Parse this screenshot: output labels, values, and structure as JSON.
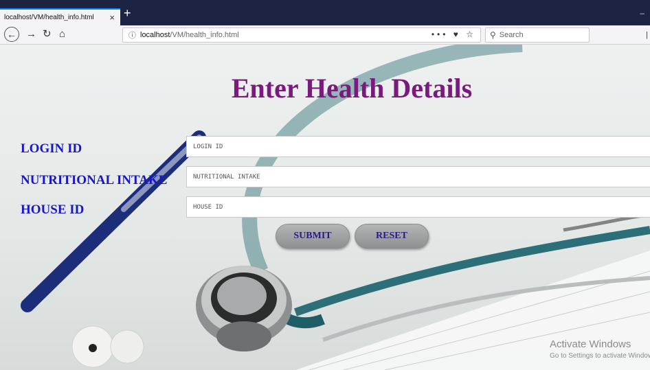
{
  "browser": {
    "tab_title": "localhost/VM/health_info.html",
    "close_glyph": "×",
    "new_tab_glyph": "+",
    "minimize_glyph": "–",
    "url_host": "localhost",
    "url_path": "/VM/health_info.html",
    "page_actions": "•••  ♥  ☆",
    "search_placeholder": "Search",
    "icons": [
      "back-arrow-icon",
      "forward-arrow-icon",
      "reload-icon",
      "home-icon",
      "info-icon",
      "pocket-icon",
      "bookmark-star-icon",
      "search-icon",
      "library-icon"
    ]
  },
  "page": {
    "heading": "Enter Health Details",
    "fields": [
      {
        "label": "LOGIN ID",
        "placeholder": "LOGIN ID"
      },
      {
        "label": "NUTRITIONAL INTAKE",
        "placeholder": "NUTRITIONAL INTAKE"
      },
      {
        "label": "HOUSE ID",
        "placeholder": "HOUSE ID"
      }
    ],
    "buttons": {
      "submit": "SUBMIT",
      "reset": "RESET"
    }
  },
  "watermark": {
    "line1": "Activate Windows",
    "line2": "Go to Settings to activate Windows."
  },
  "colors": {
    "heading": "#7b1a7e",
    "label": "#1a16c8",
    "button_text": "#2b1a80",
    "tabbar": "#1d2342"
  }
}
